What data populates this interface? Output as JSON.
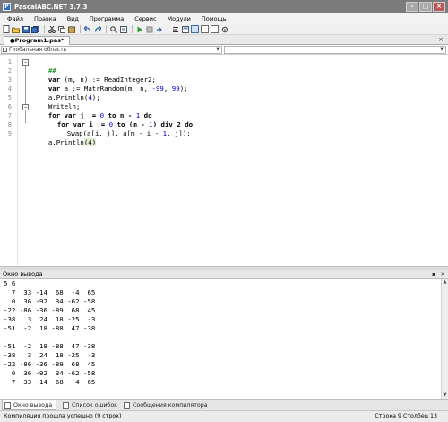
{
  "window": {
    "title": "PascalABC.NET 3.7.3",
    "app_icon": "app-logo-icon",
    "controls": [
      "minimize-icon",
      "maximize-icon",
      "close-icon"
    ]
  },
  "menu": [
    "Файл",
    "Правка",
    "Вид",
    "Программа",
    "Сервис",
    "Модули",
    "Помощь"
  ],
  "toolbar_icons": [
    "new-file-icon",
    "open-icon",
    "save-icon",
    "save-all-icon",
    "cut-icon",
    "copy-icon",
    "paste-icon",
    "undo-icon",
    "redo-icon",
    "find-icon",
    "replace-icon",
    "run-icon",
    "stop-icon",
    "step-icon",
    "format-icon",
    "view-icon",
    "layout-1-icon",
    "layout-2-icon",
    "layout-3-icon",
    "settings-icon"
  ],
  "editor_tab": {
    "label": "●Program1.pas*"
  },
  "scope": {
    "left": "Глобальная область",
    "right": ""
  },
  "code": {
    "line_numbers": [
      "1",
      "2",
      "3",
      "4",
      "5",
      "6",
      "7",
      "8",
      "9"
    ],
    "lines": [
      {
        "l": "##"
      },
      {
        "kw": "var",
        "l": " (m, n) := ReadInteger2;"
      },
      {
        "kw": "var",
        "l": " a := MatrRandom(m, n, ",
        "n1": "-99",
        "m1": ", ",
        "n2": "99",
        "r": ");"
      },
      {
        "l": "a.Println(",
        "n1": "4",
        "r": ");"
      },
      {
        "l": "Writeln;"
      },
      {
        "l": "for var j := ",
        "n1": "0",
        "m1": " to n - ",
        "n2": "1",
        "r": " do"
      },
      {
        "l": "for var i := ",
        "n1": "0",
        "m1": " to (m - ",
        "n2": "1",
        "r": ") div 2 do"
      },
      {
        "l": "Swap(a[i, j], a[m - i - ",
        "n1": "1",
        "r": ", j]);"
      },
      {
        "l": "a.Println",
        "n1": "(4)"
      }
    ]
  },
  "output_panel": {
    "title": "Окно вывода",
    "lines": [
      "5 6",
      "  7  33 -14  68  -4  65",
      "  0  36 -92  34 -62 -58",
      "-22 -86 -36 -89  68  45",
      "-38   3  24  18 -25  -3",
      "-51  -2  18 -88  47 -38",
      "",
      "-51  -2  18 -88  47 -38",
      "-38   3  24  18 -25  -3",
      "-22 -86 -36 -89  68  45",
      "  0  36 -92  34 -62 -58",
      "  7  33 -14  68  -4  65"
    ]
  },
  "bottom_tabs": [
    "Окно вывода",
    "Список ошибок",
    "Сообщения компилятора"
  ],
  "status": {
    "message": "Компиляция прошла успешно (9 строк)",
    "position": "Строка  9  Столбец  13"
  }
}
